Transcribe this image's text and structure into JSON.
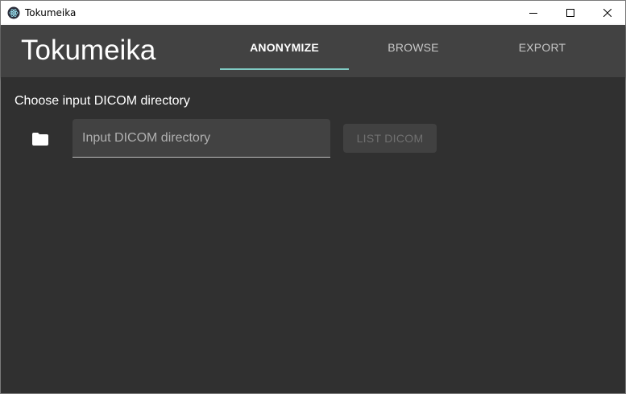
{
  "window": {
    "title": "Tokumeika",
    "icon": "electron-app-icon"
  },
  "header": {
    "brand": "Tokumeika",
    "tabs": [
      {
        "label": "ANONYMIZE",
        "active": true
      },
      {
        "label": "BROWSE",
        "active": false
      },
      {
        "label": "EXPORT",
        "active": false
      }
    ],
    "accent_color": "#80cbc4"
  },
  "main": {
    "section_label": "Choose input DICOM directory",
    "directory_input": {
      "value": "",
      "placeholder": "Input DICOM directory"
    },
    "folder_icon": "folder-icon",
    "list_button": {
      "label": "LIST DICOM",
      "disabled": true
    }
  },
  "colors": {
    "background": "#303030",
    "appbar": "#424242"
  }
}
